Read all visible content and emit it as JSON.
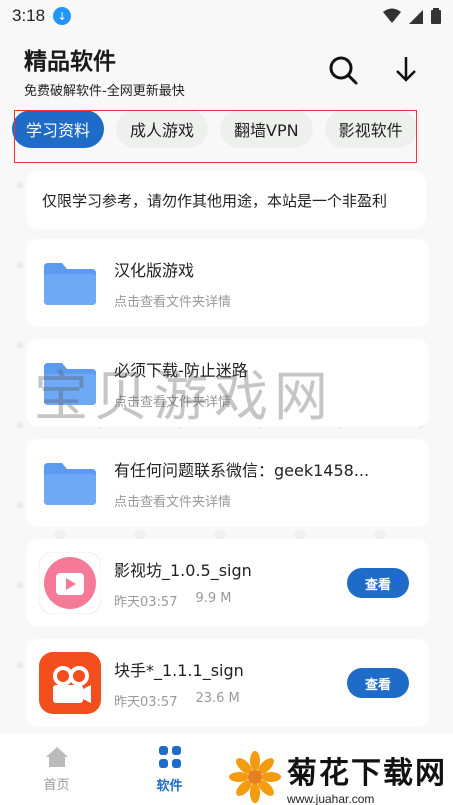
{
  "status": {
    "time": "3:18"
  },
  "header": {
    "title": "精品软件",
    "subtitle": "免费破解软件-全网更新最快"
  },
  "tabs": [
    {
      "label": "学习资料",
      "active": true
    },
    {
      "label": "成人游戏",
      "active": false
    },
    {
      "label": "翻墙VPN",
      "active": false
    },
    {
      "label": "影视软件",
      "active": false
    }
  ],
  "notice": "仅限学习参考，请勿作其他用途，本站是一个非盈利",
  "folders": [
    {
      "name": "汉化版游戏",
      "hint": "点击查看文件夹详情"
    },
    {
      "name": "必须下载-防止迷路",
      "hint": "点击查看文件夹详情"
    },
    {
      "name": "有任何问题联系微信：geek1458...",
      "hint": "点击查看文件夹详情"
    }
  ],
  "apps": [
    {
      "name": "影视坊_1.0.5_sign",
      "time": "昨天03:57",
      "size": "9.9 M",
      "button": "查看"
    },
    {
      "name": "块手*_1.1.1_sign",
      "time": "昨天03:57",
      "size": "23.6 M",
      "button": "查看"
    }
  ],
  "watermark": "宝贝游戏网",
  "nav": {
    "home": "首页",
    "software": "软件"
  },
  "brand": {
    "title": "菊花下载网",
    "url": "www.juahar.com"
  },
  "colors": {
    "accent": "#1e6bc8",
    "folder": "#5b9cf0"
  }
}
